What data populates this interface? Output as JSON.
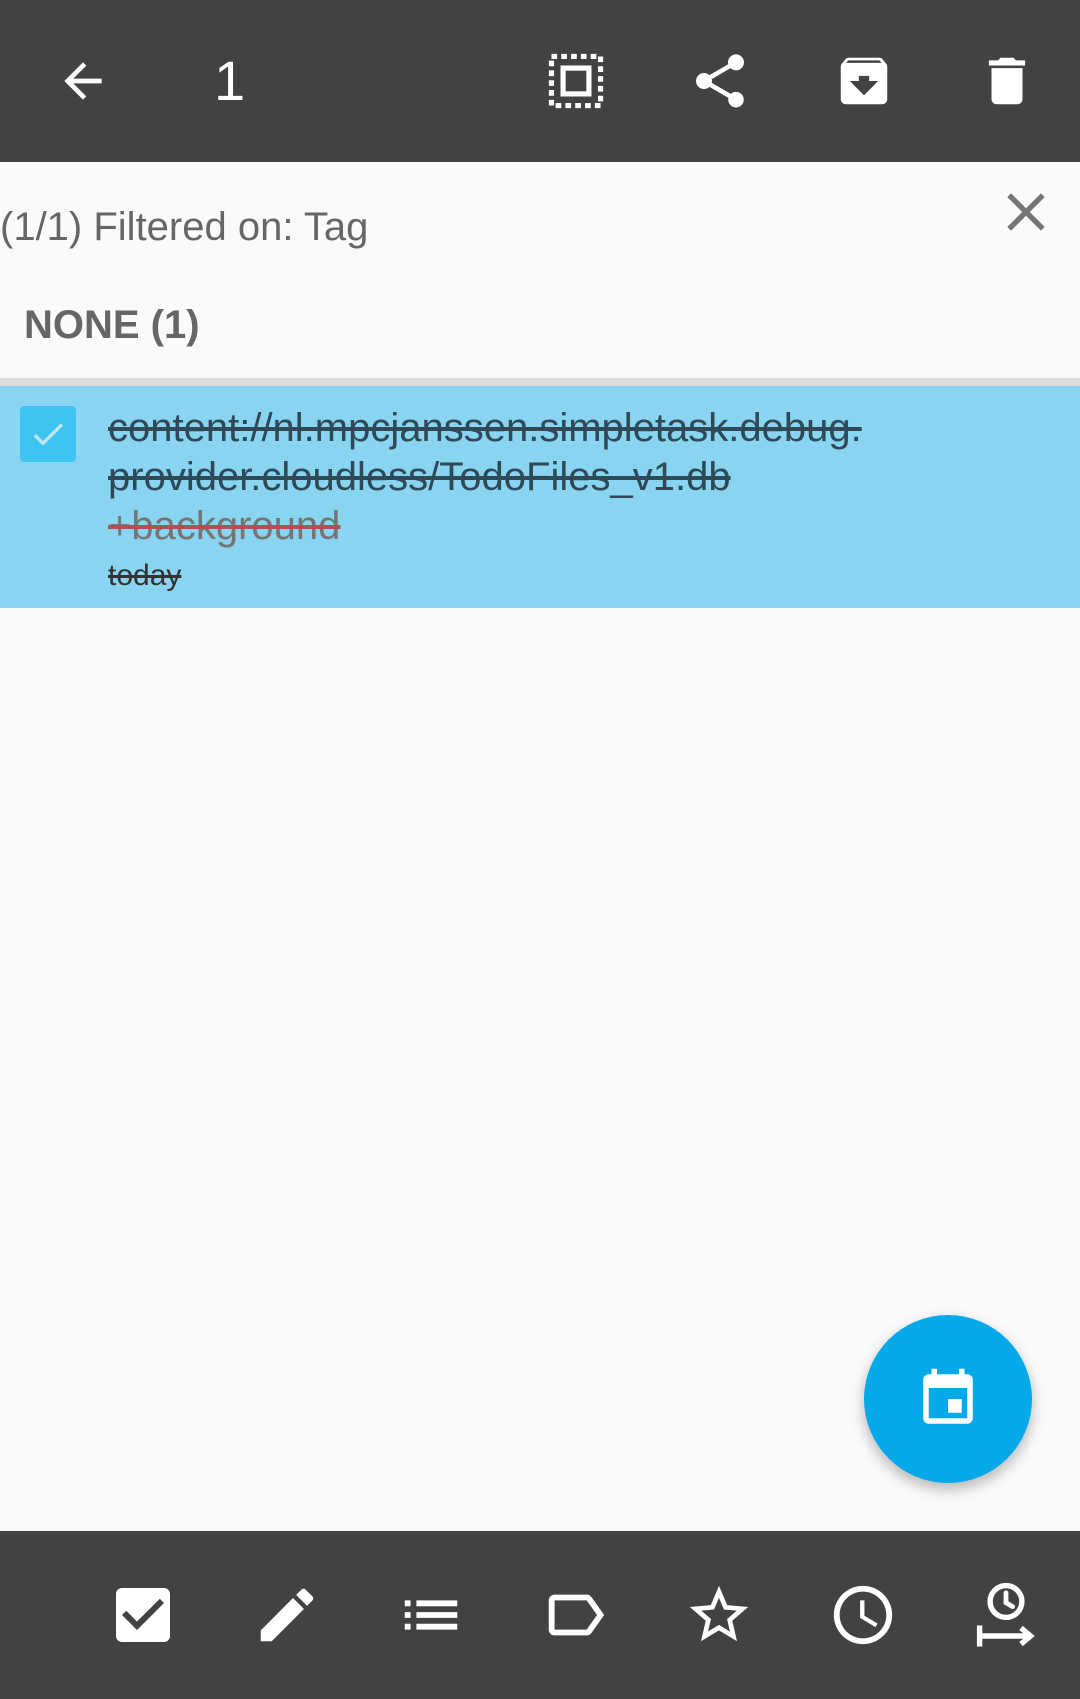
{
  "action_bar": {
    "selected_count": "1",
    "icons": [
      "back-arrow-icon",
      "select-all-icon",
      "share-icon",
      "archive-icon",
      "delete-icon"
    ]
  },
  "filter": {
    "text": "(1/1) Filtered on: Tag"
  },
  "section": {
    "header": "NONE (1)"
  },
  "tasks": [
    {
      "text": "content://nl.mpcjanssen.simpletask.debug.provider.cloudless/TodoFiles_v1.db",
      "tag": "+background",
      "date": "today",
      "checked": true
    }
  ],
  "bottom_toolbar": {
    "icons": [
      "complete-checkbox-icon",
      "edit-pencil-icon",
      "list-icon",
      "tag-icon",
      "star-icon",
      "clock-icon",
      "defer-threshold-icon"
    ]
  },
  "colors": {
    "toolbar": "#424242",
    "selection": "#88d4f1",
    "accent": "#03a9e9"
  }
}
